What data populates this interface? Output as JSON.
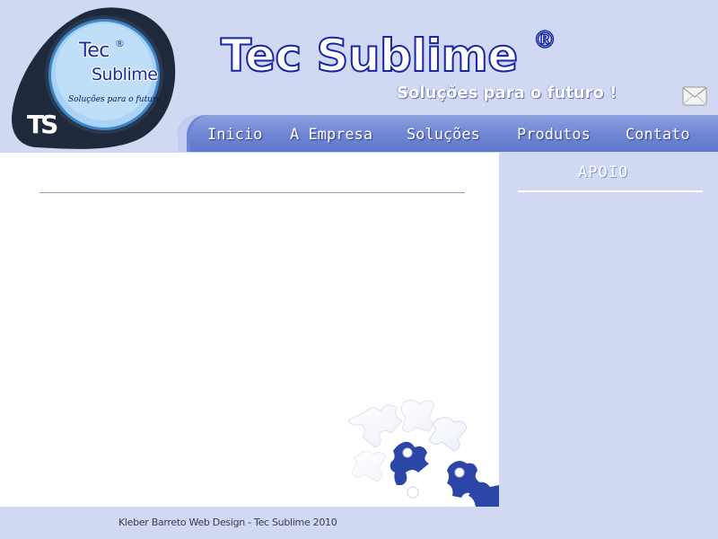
{
  "logo": {
    "line1": "Tec",
    "line2": "Sublime",
    "registered": "®",
    "tagline": "Soluções para o futuro !",
    "monogram": "TS"
  },
  "header": {
    "title": "Tec Sublime",
    "registered": "®",
    "slogan": "Soluções para o futuro !",
    "mail_icon": "envelope-icon"
  },
  "nav": {
    "items": [
      {
        "label": "Inicio"
      },
      {
        "label": "A Empresa"
      },
      {
        "label": "Soluções"
      },
      {
        "label": "Produtos"
      },
      {
        "label": "Contato"
      }
    ]
  },
  "sidebar": {
    "title": "APOIO"
  },
  "footer": {
    "text": "Kleber Barreto Web Design - Tec Sublime 2010"
  },
  "colors": {
    "background": "#d0d8f2",
    "title_outline": "#1626a6",
    "nav_bar": "#6f84d4",
    "content": "#ffffff"
  }
}
